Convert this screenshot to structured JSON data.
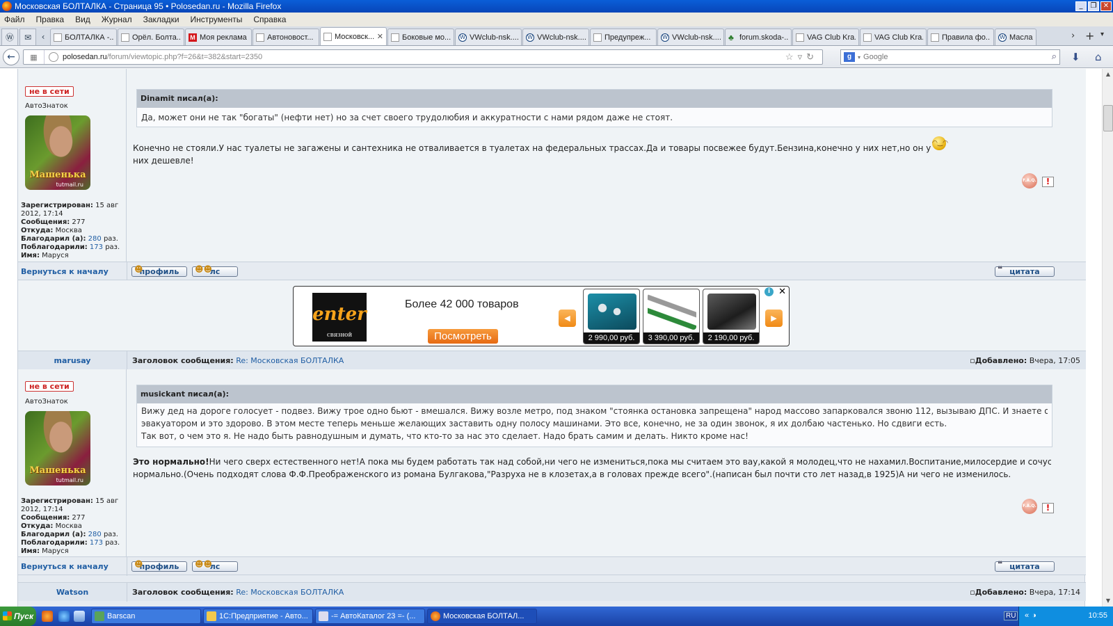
{
  "window": {
    "title": "Московская БОЛТАЛКА - Страница 95 • Polosedan.ru - Mozilla Firefox",
    "buttons": [
      "_",
      "❐",
      "✕"
    ]
  },
  "menu": [
    "Файл",
    "Правка",
    "Вид",
    "Журнал",
    "Закладки",
    "Инструменты",
    "Справка"
  ],
  "tabs": [
    {
      "label": "БОЛТАЛКА -...",
      "icon": "page"
    },
    {
      "label": "Орёл. Болта...",
      "icon": "page"
    },
    {
      "label": "Моя реклама",
      "icon": "m"
    },
    {
      "label": "Автоновост...",
      "icon": "page"
    },
    {
      "label": "Московск...",
      "icon": "page",
      "active": true
    },
    {
      "label": "Боковые мо...",
      "icon": "page"
    },
    {
      "label": "VWclub-nsk....",
      "icon": "vw"
    },
    {
      "label": "VWclub-nsk....",
      "icon": "vw"
    },
    {
      "label": "Предупреж...",
      "icon": "page"
    },
    {
      "label": "VWclub-nsk....",
      "icon": "vw"
    },
    {
      "label": "forum.skoda-...",
      "icon": "tree"
    },
    {
      "label": "VAG Club Kra...",
      "icon": "page"
    },
    {
      "label": "VAG Club Kra...",
      "icon": "page"
    },
    {
      "label": "Правила фо...",
      "icon": "page"
    },
    {
      "label": "Масла",
      "icon": "vw"
    }
  ],
  "nav": {
    "url_host": "polosedan.ru",
    "url_path": "/forum/viewtopic.php?f=26&t=382&start=2350",
    "search_placeholder": "Google"
  },
  "posts": [
    {
      "status": "не в сети",
      "rank": "АвтоЗнаток",
      "avatar_text": "Машенька",
      "avatar_site": "tutmail.ru",
      "info": {
        "registered_label": "Зарегистрирован:",
        "registered": "15 авг 2012, 17:14",
        "messages_label": "Сообщения:",
        "messages": "277",
        "from_label": "Откуда:",
        "from": "Москва",
        "thanked_label": "Благодарил (а):",
        "thanked": "280",
        "thanked_suffix": "раз.",
        "thanks_label": "Поблагодарили:",
        "thanks": "173",
        "thanks_suffix": "раз.",
        "name_label": "Имя:",
        "name": "Маруся"
      },
      "quote_author": "Dinamit писал(а):",
      "quote_text": "Да, может они не так \"богаты\" (нефти нет) но за счет своего трудолюбия и аккуратности с нами рядом даже не стоят.",
      "text": "Конечно не стояли.У нас туалеты не загажены и сантехника не отваливается в туалетах на федеральных трассах.Да и товары посвежее будут.Бензина,конечно у них нет,но он у них дешевле!"
    },
    {
      "author": "marusay",
      "subject_label": "Заголовок сообщения:",
      "subject": "Re: Московская БОЛТАЛКА",
      "added_label": "Добавлено:",
      "added": "Вчера, 17:05",
      "status": "не в сети",
      "rank": "АвтоЗнаток",
      "avatar_text": "Машенька",
      "avatar_site": "tutmail.ru",
      "info": {
        "registered_label": "Зарегистрирован:",
        "registered": "15 авг 2012, 17:14",
        "messages_label": "Сообщения:",
        "messages": "277",
        "from_label": "Откуда:",
        "from": "Москва",
        "thanked_label": "Благодарил (а):",
        "thanked": "280",
        "thanked_suffix": "раз.",
        "thanks_label": "Поблагодарили:",
        "thanks": "173",
        "thanks_suffix": "раз.",
        "name_label": "Имя:",
        "name": "Маруся"
      },
      "quote_author": "musickant писал(а):",
      "quote_line1": "Вижу дед на дороге голосует - подвез. Вижу трое одно бьют - вмешался. Вижу возле метро, под знаком \"стоянка остановка запрещена\" народ массово запарковался звоню 112, вызываю ДПС. И знаете они приезжаю с",
      "quote_line2": "эвакуатором и это здорово. В этом месте теперь меньше желающих заставить одну полосу машинами. Это все, конечно, не за один звонок, я их долбаю частенько. Но сдвиги есть.",
      "quote_line3": "Так вот, о чем это я. Не надо быть равнодушным и думать, что кто-то за нас это сделает. Надо брать самим и делать. Никто кроме нас!",
      "text_bold": "Это нормально!",
      "text_line1": "Ни чего сверх естественного нет!А пока мы будем работать так над собой,ни чего не измениться,пока мы считаем это вау,какой я молодец,что не нахамил.Воспитание,милосердие и сочуствие-это",
      "text_line2": "нормально.(Очень подходят слова Ф.Ф.Преображенского из романа Булгакова,\"Разруха не в клозетах,а в головах прежде всего\".(написан был почти сто лет назад,в 1925)А ни чего не изменилось."
    },
    {
      "author": "Watson",
      "subject_label": "Заголовок сообщения:",
      "subject": "Re: Московская БОЛТАЛКА",
      "added_label": "Добавлено:",
      "added": "Вчера, 17:14"
    }
  ],
  "footer": {
    "to_top": "Вернуться к началу",
    "profile": "профиль",
    "pm": "лс",
    "quote": "цитата",
    "faq_icon_text": "F.A.Q."
  },
  "ad": {
    "logo": "enter",
    "logo_sub": "СВЯЗНОЙ",
    "headline": "Более 42 000 товаров",
    "button": "Посмотреть",
    "items": [
      {
        "price": "2 990,00 руб."
      },
      {
        "price": "3 390,00 руб."
      },
      {
        "price": "2 190,00 руб."
      }
    ]
  },
  "taskbar": {
    "start": "Пуск",
    "tasks": [
      "Barscan",
      "1С:Предприятие - Авто...",
      "-= АвтоКаталог 23 =- (...",
      "Московская БОЛТАЛ..."
    ],
    "lang": "RU",
    "clock": "10:55"
  },
  "colors": {
    "title_bar": "#0a5ed8",
    "forum_bg": "#e6ebf1",
    "link": "#1f5da3",
    "offline": "#cc2222",
    "ad_orange": "#f08a16"
  }
}
